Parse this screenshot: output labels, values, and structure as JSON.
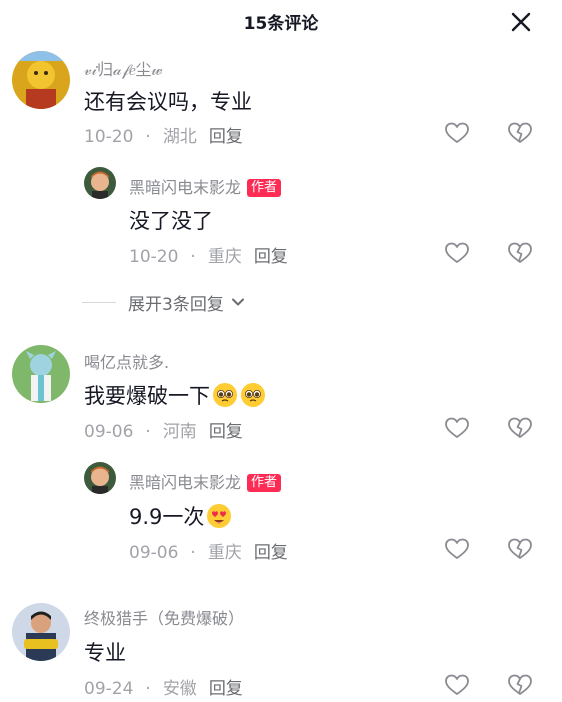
{
  "header": {
    "title": "15条评论"
  },
  "comments": [
    {
      "name": "𝓋𝒾归𝒶𝒻𝑒尘𝓌",
      "text": "还有会议吗，专业",
      "date": "10-20",
      "location": "湖北",
      "reply": "回复"
    },
    {
      "name": "黑暗闪电末影龙",
      "badge": "作者",
      "text": "没了没了",
      "date": "10-20",
      "location": "重庆",
      "reply": "回复"
    },
    {
      "name": "喝亿点就多.",
      "text": "我要爆破一下",
      "date": "09-06",
      "location": "河南",
      "reply": "回复"
    },
    {
      "name": "黑暗闪电末影龙",
      "badge": "作者",
      "text": "9.9一次",
      "date": "09-06",
      "location": "重庆",
      "reply": "回复"
    },
    {
      "name": "终极猎手（免费爆破）",
      "text": "专业",
      "date": "09-24",
      "location": "安徽",
      "reply": "回复"
    }
  ],
  "expand": {
    "label": "展开3条回复"
  },
  "separator": "·",
  "icons": {
    "close": "close-icon",
    "like": "heart-outline-icon",
    "dislike": "broken-heart-icon",
    "chevron": "chevron-down-icon"
  },
  "colors": {
    "author_badge": "#fe2c55",
    "meta": "#a2a3a8",
    "name": "#8a8b91",
    "text": "#161823"
  }
}
